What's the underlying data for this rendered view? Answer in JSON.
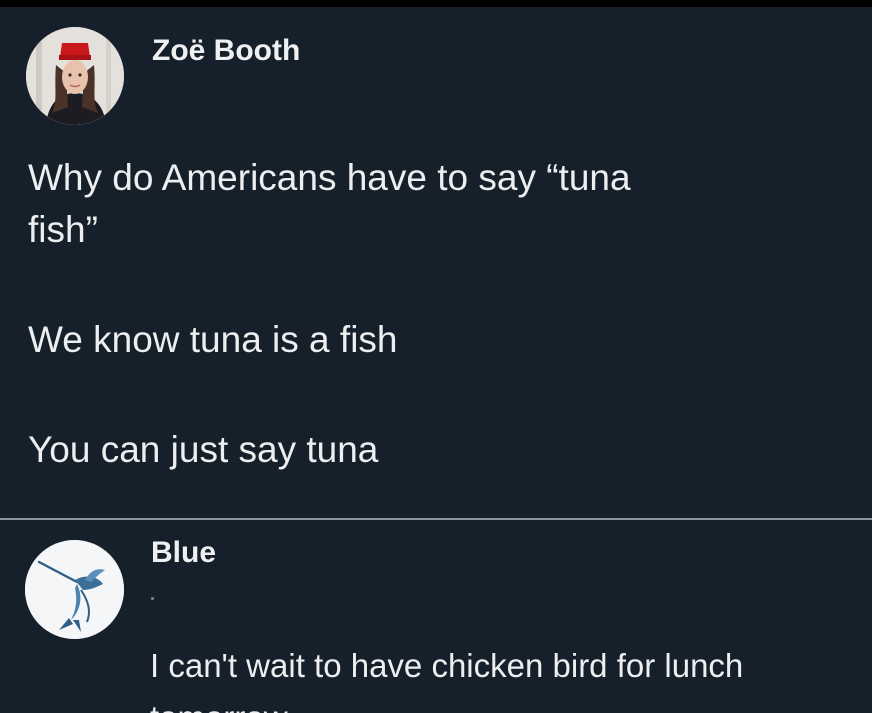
{
  "post": {
    "author_name": "Zoë Booth",
    "avatar_icon": "profile-photo-person-red-fez",
    "lines": [
      "Why do Americans have to say “tuna",
      "fish”",
      "We know tuna is a fish",
      "You can just say tuna"
    ]
  },
  "reply": {
    "author_name": "Blue",
    "avatar_icon": "marlin-fish-logo",
    "lines": [
      "I can't wait to have chicken bird for lunch",
      "tomorrow"
    ]
  },
  "colors": {
    "background": "#16202b",
    "text": "#e7e9ea",
    "divider": "#8c949c"
  }
}
